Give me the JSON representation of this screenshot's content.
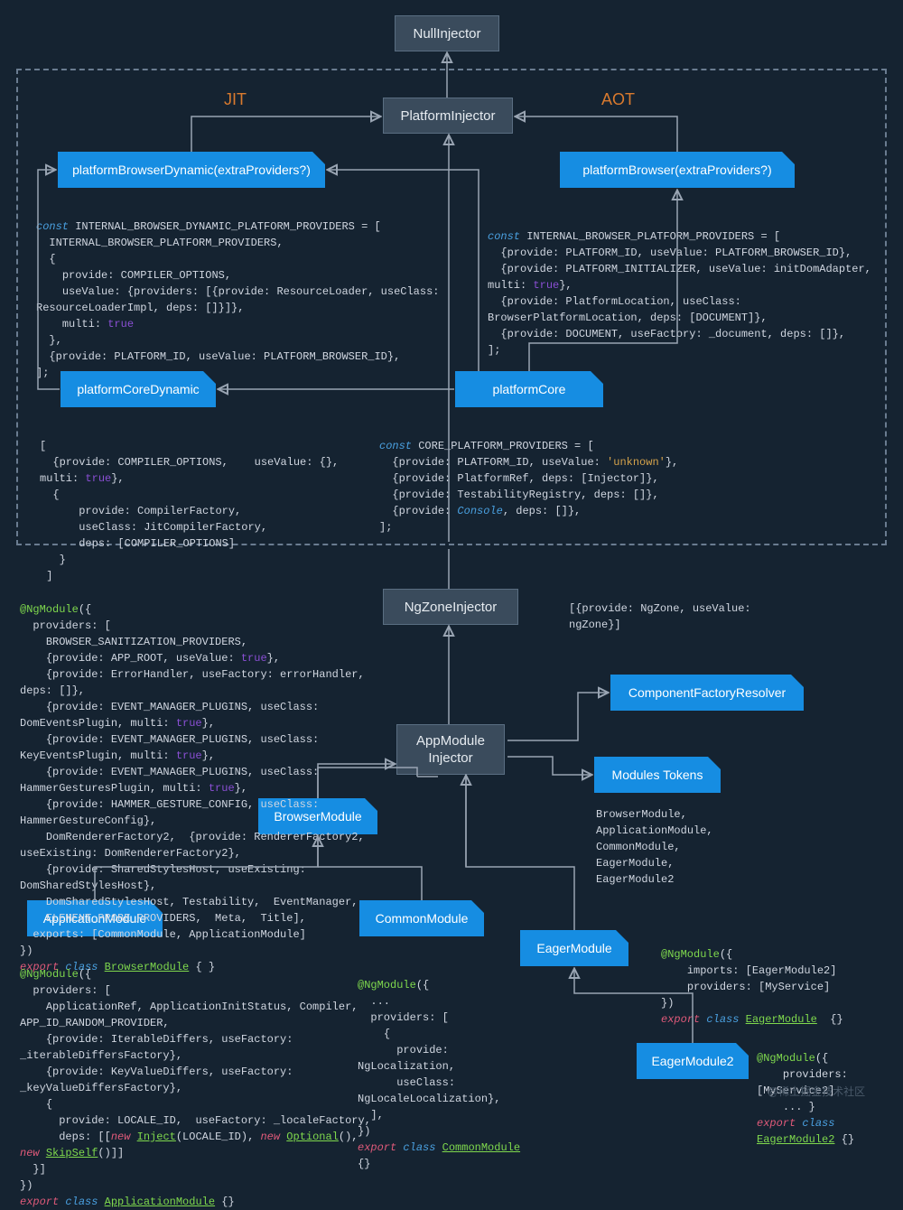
{
  "labels": {
    "jit": "JIT",
    "aot": "AOT"
  },
  "nodes": {
    "null_injector": "NullInjector",
    "platform_injector": "PlatformInjector",
    "platform_browser_dynamic": "platformBrowserDynamic(extraProviders?)",
    "platform_browser": "platformBrowser(extraProviders?)",
    "platform_core_dynamic": "platformCoreDynamic",
    "platform_core": "platformCore",
    "ngzone_injector": "NgZoneInjector",
    "appmodule_injector": "AppModule\nInjector",
    "component_factory_resolver": "ComponentFactoryResolver",
    "modules_tokens": "Modules Tokens",
    "browser_module": "BrowserModule",
    "application_module": "ApplicationModule",
    "common_module": "CommonModule",
    "eager_module": "EagerModule",
    "eager_module2": "EagerModule2"
  },
  "code": {
    "jit_providers": "const INTERNAL_BROWSER_DYNAMIC_PLATFORM_PROVIDERS = [\n  INTERNAL_BROWSER_PLATFORM_PROVIDERS,\n  {\n    provide: COMPILER_OPTIONS,\n    useValue: {providers: [{provide: ResourceLoader, useClass: ResourceLoaderImpl, deps: []}]},\n    multi: true\n  },\n  {provide: PLATFORM_ID, useValue: PLATFORM_BROWSER_ID},\n];",
    "aot_providers": "const INTERNAL_BROWSER_PLATFORM_PROVIDERS = [\n  {provide: PLATFORM_ID, useValue: PLATFORM_BROWSER_ID},\n  {provide: PLATFORM_INITIALIZER, useValue: initDomAdapter, multi: true},\n  {provide: PlatformLocation, useClass: BrowserPlatformLocation, deps: [DOCUMENT]},\n  {provide: DOCUMENT, useFactory: _document, deps: []},\n];",
    "core_dynamic_providers": "[\n  {provide: COMPILER_OPTIONS,    useValue: {}, multi: true},\n  {\n      provide: CompilerFactory,\n      useClass: JitCompilerFactory,\n      deps: [COMPILER_OPTIONS]\n   }\n ]",
    "core_platform_providers": "const CORE_PLATFORM_PROVIDERS = [\n  {provide: PLATFORM_ID, useValue: 'unknown'},\n  {provide: PlatformRef, deps: [Injector]},\n  {provide: TestabilityRegistry, deps: []},\n  {provide: Console, deps: []},\n];",
    "ngzone_code": "[{provide: NgZone, useValue: ngZone}]",
    "browser_module_code": "@NgModule({\n  providers: [\n    BROWSER_SANITIZATION_PROVIDERS,\n    {provide: APP_ROOT, useValue: true},\n    {provide: ErrorHandler, useFactory: errorHandler, deps: []},\n    {provide: EVENT_MANAGER_PLUGINS, useClass: DomEventsPlugin, multi: true},\n    {provide: EVENT_MANAGER_PLUGINS, useClass: KeyEventsPlugin, multi: true},\n    {provide: EVENT_MANAGER_PLUGINS, useClass: HammerGesturesPlugin, multi: true},\n    {provide: HAMMER_GESTURE_CONFIG, useClass: HammerGestureConfig},\n    DomRendererFactory2,  {provide: RendererFactory2, useExisting: DomRendererFactory2},\n    {provide: SharedStylesHost, useExisting: DomSharedStylesHost},\n    DomSharedStylesHost, Testability,  EventManager,\n    ELEMENT_PROBE_PROVIDERS,  Meta,  Title],\n  exports: [CommonModule, ApplicationModule]\n})\nexport class BrowserModule { }",
    "modules_list": "BrowserModule,\nApplicationModule,\nCommonModule,\nEagerModule,\nEagerModule2",
    "application_module_code": "@NgModule({\n  providers: [\n    ApplicationRef, ApplicationInitStatus, Compiler,  APP_ID_RANDOM_PROVIDER,\n    {provide: IterableDiffers, useFactory: _iterableDiffersFactory},\n    {provide: KeyValueDiffers, useFactory: _keyValueDiffersFactory},\n    {\n      provide: LOCALE_ID,  useFactory: _localeFactory,\n      deps: [[new Inject(LOCALE_ID), new Optional(), new SkipSelf()]]\n  }]\n})\nexport class ApplicationModule {}",
    "common_module_code": "@NgModule({\n  ...\n  providers: [\n    {\n      provide: NgLocalization,\n      useClass: NgLocaleLocalization},\n  ],\n})\nexport class CommonModule {}",
    "eager_module_code": "@NgModule({\n    imports: [EagerModule2]\n    providers: [MyService]\n})\nexport class EagerModule  {}",
    "eager_module2_code": "@NgModule({\n    providers: [MyService2]\n    ... }\nexport class EagerModule2 {}"
  },
  "watermark": "@稀土掘金技术社区"
}
